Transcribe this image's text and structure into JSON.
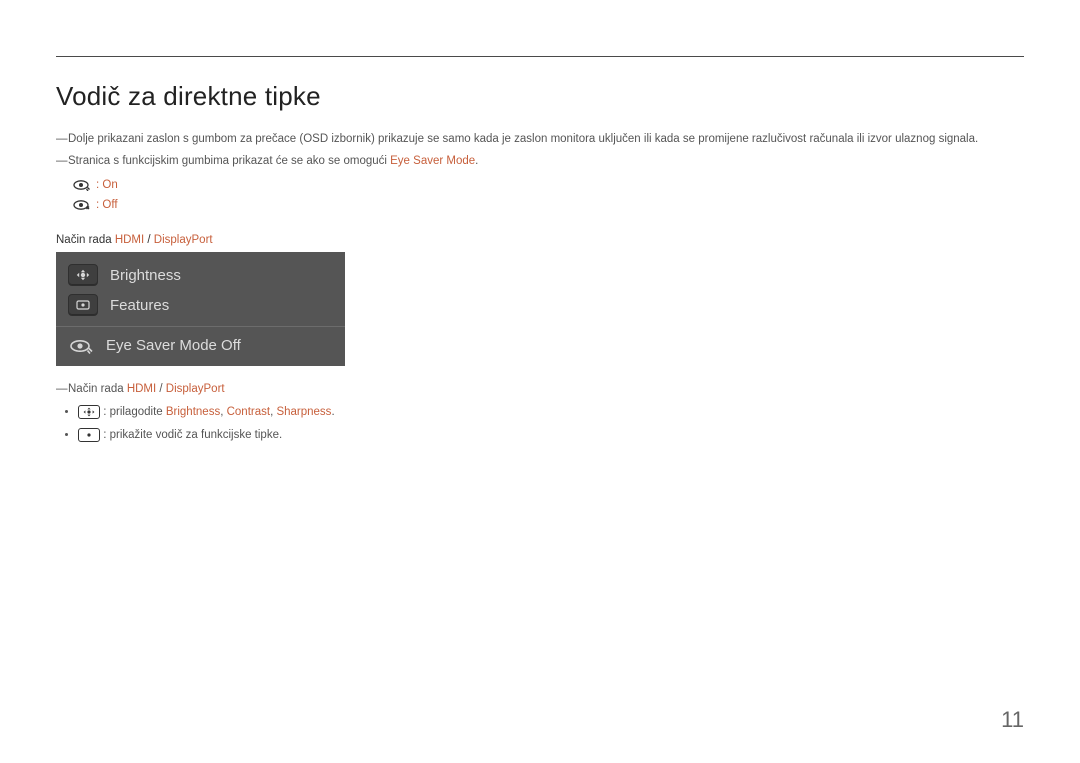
{
  "title": "Vodič za direktne tipke",
  "note1_prefix": "Dolje prikazani zaslon s gumbom za prečace (OSD izbornik) prikazuje se samo kada je zaslon monitora uključen ili kada se promijene razlučivost računala ili izvor ulaznog signala.",
  "note2_prefix": "Stranica s funkcijskim gumbima prikazat će se ako se omogući ",
  "note2_hl": "Eye Saver Mode",
  "note2_suffix": ".",
  "eye_on_label": ": On",
  "eye_off_label": ": Off",
  "mode_label": "Način rada ",
  "mode_hdmi": "HDMI",
  "mode_sep": " / ",
  "mode_dp": "DisplayPort",
  "osd": {
    "brightness": "Brightness",
    "features": "Features",
    "eyesaver": "Eye Saver Mode Off"
  },
  "post_note_prefix": "Način rada ",
  "post_note_hdmi": "HDMI",
  "post_note_sep": " / ",
  "post_note_dp": "DisplayPort",
  "bullet1_prefix": " : prilagodite ",
  "bullet1_b": "Brightness",
  "bullet1_comma1": ", ",
  "bullet1_c": "Contrast",
  "bullet1_comma2": ", ",
  "bullet1_s": "Sharpness",
  "bullet1_end": ".",
  "bullet2": " : prikažite vodič za funkcijske tipke.",
  "page_number": "11"
}
